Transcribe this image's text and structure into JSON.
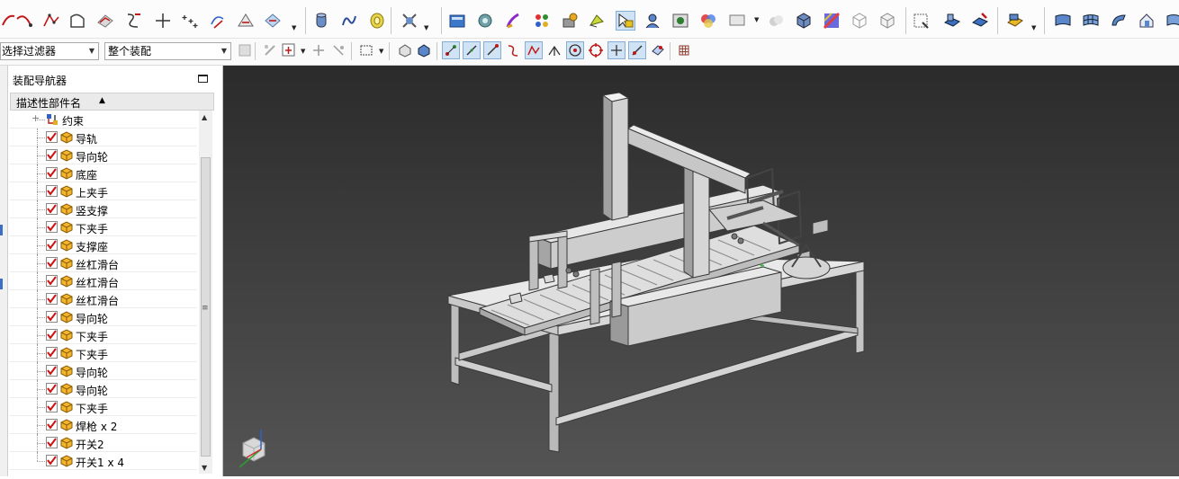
{
  "toolbar": {
    "row1_icons": [
      "arc-icon",
      "curve-icon",
      "polyline-icon",
      "sketch-icon",
      "extrude-icon",
      "curve-fit-icon",
      "cross-point-icon",
      "point-set-icon",
      "edit-curve-icon",
      "offset-curve-icon",
      "project-icon",
      "cylinder-icon",
      "spring-icon",
      "coil-icon",
      "assembly-tool-icon",
      "render-icon",
      "camera-icon",
      "paint-icon",
      "color-palette-icon",
      "bake-icon",
      "material-icon",
      "highlight-icon",
      "user-icon",
      "scene-icon",
      "studio-icon",
      "display-icon",
      "shade-icon",
      "cube-icon",
      "texture-icon",
      "wire-cube-icon",
      "section-cube-icon",
      "frame-icon",
      "solid-icon",
      "edit-solid-icon",
      "part-icon",
      "surface-icon",
      "mesh-surface-icon",
      "sweep-surface-icon",
      "offset-surface-icon",
      "more-icon"
    ],
    "filter_combo": "选择过滤器",
    "assembly_combo": "整个装配",
    "row2_icons": [
      "snap-icon",
      "move-part-icon",
      "constraint-icon",
      "select-rect-icon",
      "view-cube-icon",
      "shade-cube-icon",
      "snap-end-icon",
      "snap-line-icon",
      "snap-slash-icon",
      "snap-curve-icon",
      "snap-poly-icon",
      "snap-angle-icon",
      "snap-center-icon",
      "snap-quadrant-icon",
      "snap-cross-icon",
      "snap-tangent-icon",
      "snap-face-icon",
      "snap-grid-icon"
    ]
  },
  "navigator": {
    "title": "装配导航器",
    "column_header": "描述性部件名",
    "rows": [
      {
        "label": "约束"
      },
      {
        "label": "导轨"
      },
      {
        "label": "导向轮"
      },
      {
        "label": "底座"
      },
      {
        "label": "上夹手"
      },
      {
        "label": "竖支撑"
      },
      {
        "label": "下夹手"
      },
      {
        "label": "支撑座"
      },
      {
        "label": "丝杠滑台"
      },
      {
        "label": "丝杠滑台"
      },
      {
        "label": "丝杠滑台"
      },
      {
        "label": "导向轮"
      },
      {
        "label": "下夹手"
      },
      {
        "label": "下夹手"
      },
      {
        "label": "导向轮"
      },
      {
        "label": "导向轮"
      },
      {
        "label": "下夹手"
      },
      {
        "label": "焊枪 x 2"
      },
      {
        "label": "开关2"
      },
      {
        "label": "开关1 x 4"
      }
    ]
  },
  "colors": {
    "checkbox_red": "#d01010",
    "part_yellow": "#f2b530",
    "toolbar_highlight": "#cfe3f5",
    "viewport_top": "#2b2b2b",
    "viewport_bottom": "#545454"
  }
}
